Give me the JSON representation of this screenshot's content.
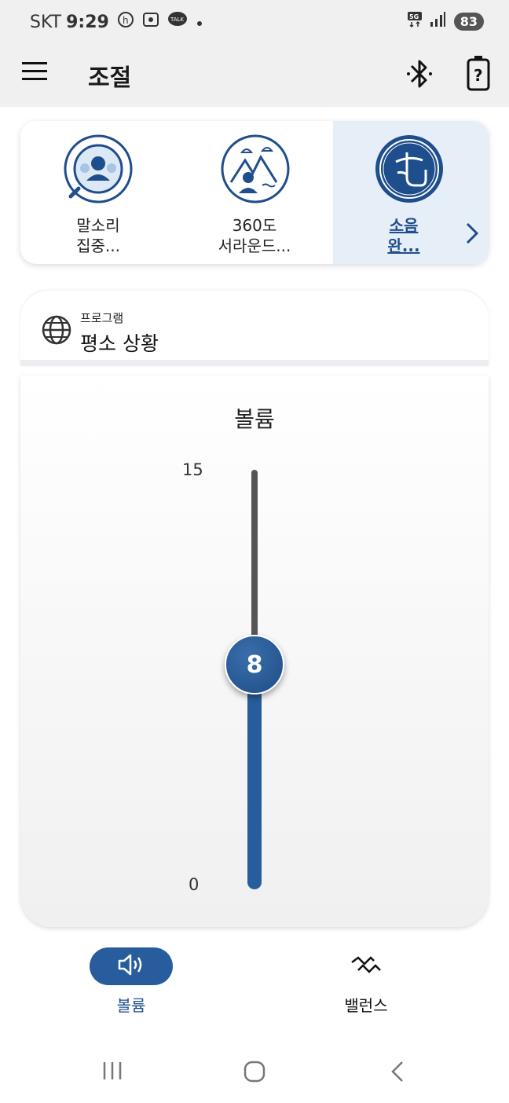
{
  "status_bar": {
    "carrier": "SKT",
    "time": "9:29",
    "network": "5G",
    "battery": "83"
  },
  "app_bar": {
    "title": "조절"
  },
  "modes": [
    {
      "label_line1": "말소리",
      "label_line2": "집중...",
      "icon": "speech-focus-icon",
      "active": false
    },
    {
      "label_line1": "360도",
      "label_line2": "서라운드...",
      "icon": "surround-360-icon",
      "active": false
    },
    {
      "label_line1": "소음",
      "label_line2": "완...",
      "icon": "noise-reduction-icon",
      "active": true
    }
  ],
  "program": {
    "caption": "프로그램",
    "name": "평소 상황"
  },
  "volume": {
    "title": "볼륨",
    "max": "15",
    "min": "0",
    "value": "8"
  },
  "bottom_tabs": {
    "volume_label": "볼륨",
    "balance_label": "밸런스"
  },
  "colors": {
    "accent": "#275d9c",
    "active_bg": "#e6eef8",
    "bar_bg": "#f0f0f0"
  }
}
